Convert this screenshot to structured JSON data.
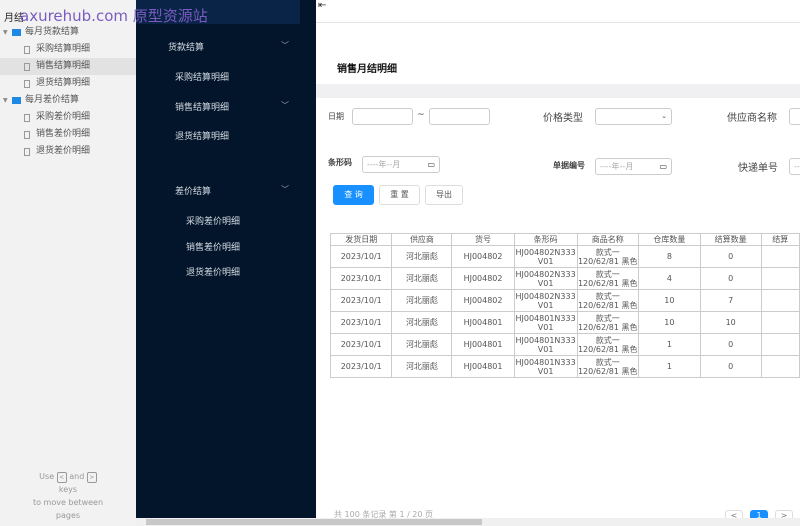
{
  "sidebar": {
    "title": "月结",
    "watermark": "axurehub.com 原型资源站",
    "folders": [
      {
        "label": "每月货款结算",
        "items": [
          "采购结算明细",
          "销售结算明细",
          "退货结算明细"
        ]
      },
      {
        "label": "每月差价结算",
        "items": [
          "采购差价明细",
          "销售差价明细",
          "退货差价明细"
        ]
      }
    ],
    "selected": "销售结算明细",
    "help": {
      "use": "Use",
      "and": "and",
      "keys": "keys",
      "move": "to move between",
      "pages": "pages",
      "prev_key": "<",
      "next_key": ">"
    }
  },
  "nav": {
    "groups": [
      {
        "label": "货款结算",
        "items": [
          "采购结算明细",
          "销售结算明细",
          "退货结算明细"
        ]
      },
      {
        "label": "差价结算",
        "items": [
          "采购差价明细",
          "销售差价明细",
          "退货差价明细"
        ]
      }
    ]
  },
  "header": {
    "menu_icon": "menu-fold-icon"
  },
  "page": {
    "title": "销售月结明细"
  },
  "filters": {
    "date": "日期",
    "tilde": "~",
    "price_type": "价格类型",
    "supplier": "供应商名称",
    "barcode": "条形码",
    "barcode_placeholder": "----年--月",
    "doc_no": "单据编号",
    "doc_placeholder": "----年--月",
    "express": "快递单号",
    "express_placeholder": "--"
  },
  "buttons": {
    "query": "查 询",
    "reset": "重 置",
    "export": "导出"
  },
  "table": {
    "headers": [
      "发货日期",
      "供应商",
      "货号",
      "条形码",
      "商品名称",
      "仓库数量",
      "结算数量",
      "结算"
    ],
    "rows": [
      [
        "2023/10/1",
        "河北丽彪",
        "HJ004802",
        "HJ004802N333 V01",
        "款式一 120/62/81 黑色",
        "8",
        "0",
        ""
      ],
      [
        "2023/10/1",
        "河北丽彪",
        "HJ004802",
        "HJ004802N333 V01",
        "款式一 120/62/81 黑色",
        "4",
        "0",
        ""
      ],
      [
        "2023/10/1",
        "河北丽彪",
        "HJ004802",
        "HJ004802N333 V01",
        "款式一 120/62/81 黑色",
        "10",
        "7",
        ""
      ],
      [
        "2023/10/1",
        "河北丽彪",
        "HJ004801",
        "HJ004801N333 V01",
        "款式一 120/62/81 黑色",
        "10",
        "10",
        ""
      ],
      [
        "2023/10/1",
        "河北丽彪",
        "HJ004801",
        "HJ004801N333 V01",
        "款式一 120/62/81 黑色",
        "1",
        "0",
        ""
      ],
      [
        "2023/10/1",
        "河北丽彪",
        "HJ004801",
        "HJ004801N333 V01",
        "款式一 120/62/81 黑色",
        "1",
        "0",
        ""
      ]
    ]
  },
  "pagination": {
    "summary": "共 100 条记录 第 1 / 20 页",
    "prev": "<",
    "current": "1",
    "next": ">"
  },
  "colors": {
    "nav_bg": "#02152b",
    "primary": "#1890ff"
  }
}
